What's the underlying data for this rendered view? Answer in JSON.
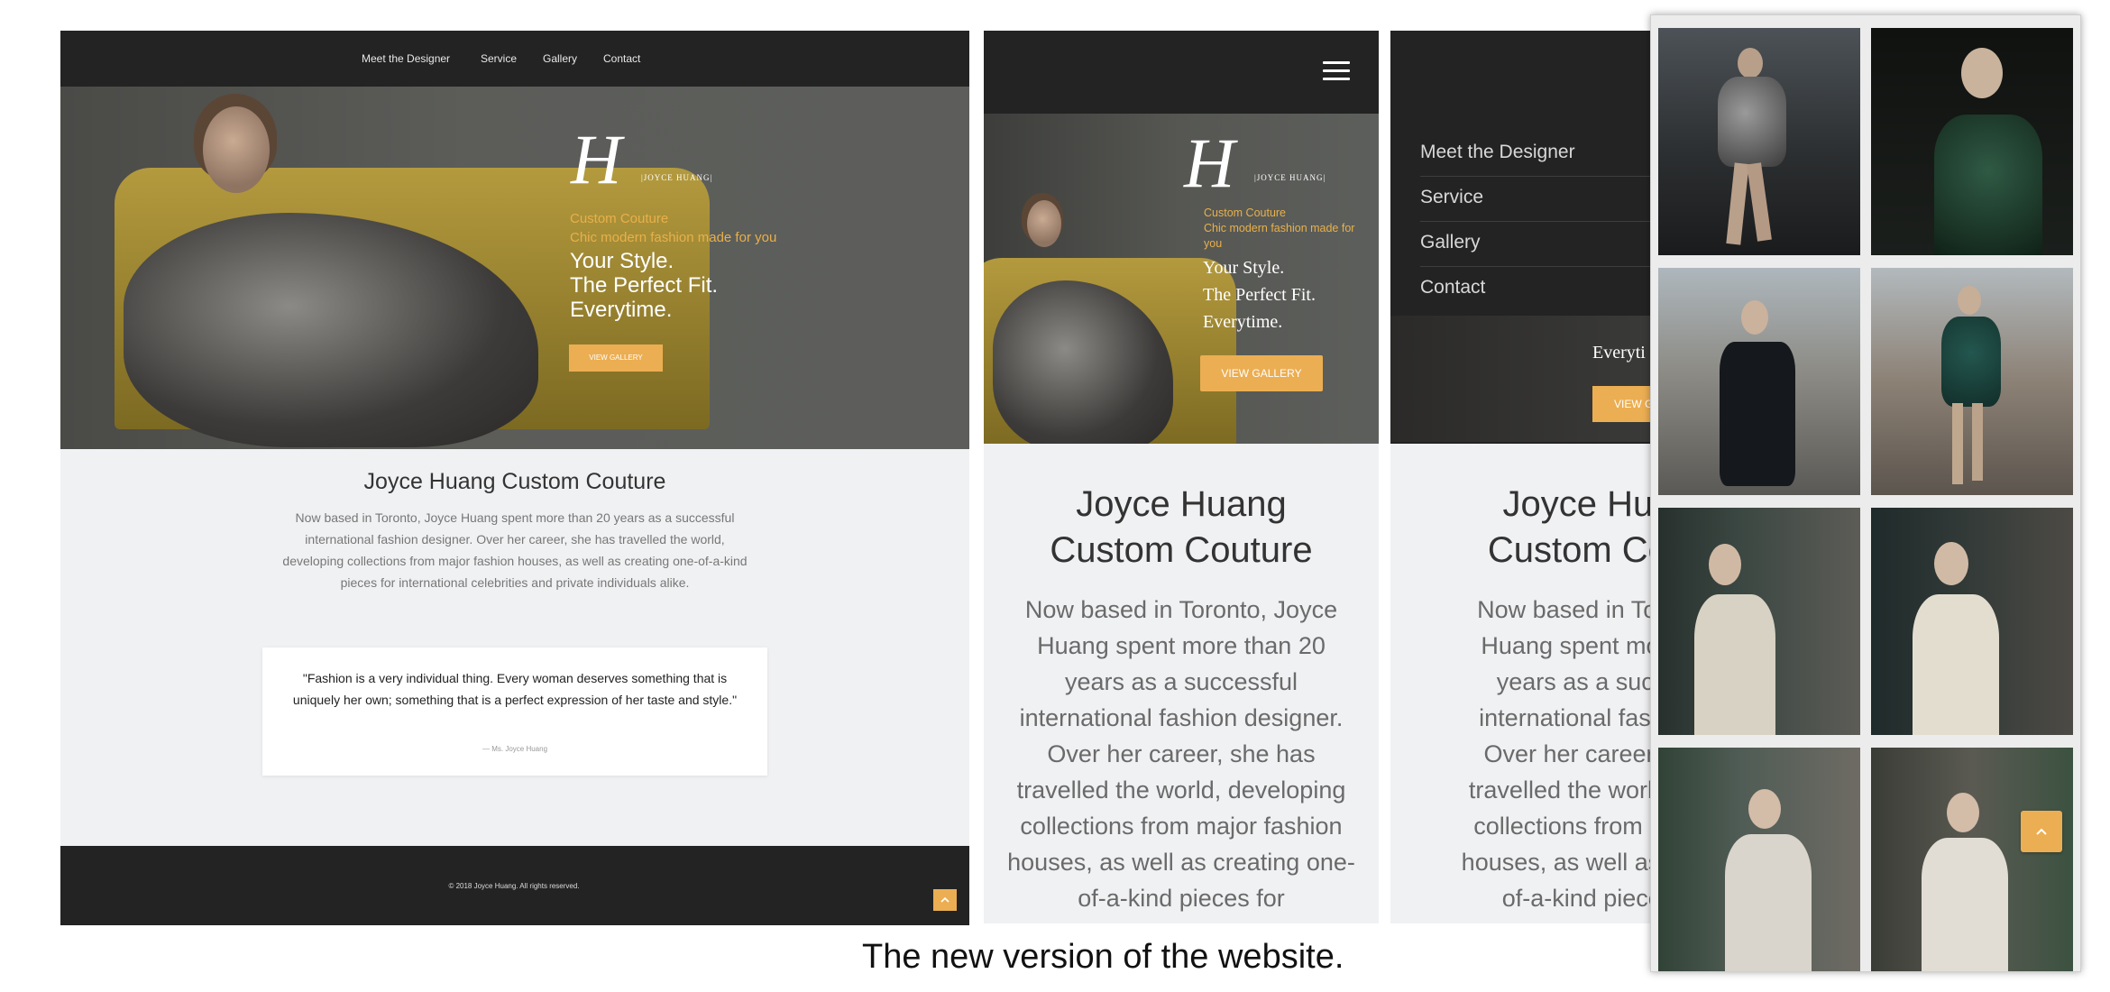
{
  "desktop": {
    "nav": [
      "Meet the Designer",
      "Service",
      "Gallery",
      "Contact"
    ],
    "logo_name": "|JOYCE HUANG|",
    "tagline1": "Custom Couture",
    "tagline2": "Chic modern fashion made for you",
    "headline": [
      "Your Style.",
      "The Perfect Fit.",
      "Everytime."
    ],
    "cta": "VIEW GALLERY",
    "section_title": "Joyce Huang Custom Couture",
    "about": "Now based in Toronto, Joyce Huang spent more than 20 years as a successful international fashion designer. Over her career, she has travelled the world, developing collections from major fashion houses, as well as creating one-of-a-kind pieces for international celebrities and private individuals alike.",
    "quote": "\"Fashion is a very individual thing. Every woman deserves something that is uniquely her own; something that is a perfect expression of her taste and style.\"",
    "quote_author": "— Ms. Joyce Huang",
    "footer": "© 2018 Joyce Huang. All rights reserved.",
    "up_icon": "chevron-up-icon"
  },
  "mobile": {
    "menu_icon": "hamburger-menu-icon",
    "logo_name": "|JOYCE HUANG|",
    "tagline1": "Custom Couture",
    "tagline2": "Chic modern fashion made for you",
    "headline": [
      "Your Style.",
      "The Perfect Fit.",
      "Everytime."
    ],
    "cta": "VIEW GALLERY",
    "section_title": [
      "Joyce Huang",
      "Custom Couture"
    ],
    "about_lines": [
      "Now based in Toronto, Joyce",
      "Huang spent more than 20",
      "years as a successful",
      "international fashion designer.",
      "Over her career, she has",
      "travelled the world, developing",
      "collections from major fashion",
      "houses, as well as creating one-",
      "of-a-kind pieces for"
    ]
  },
  "mobile_menu": {
    "items": [
      "Meet the Designer",
      "Service",
      "Gallery",
      "Contact"
    ],
    "peek_headline": "Everyti",
    "peek_cta": "VIEW G",
    "section_title": [
      "Joyce Hua",
      "Custom Cou"
    ],
    "about_lines": [
      "Now based in Toront",
      "Huang spent more t",
      "years as a succe",
      "international fashion",
      "Over her career, sh",
      "travelled the world, de",
      "collections from majo",
      "houses, as well as crea",
      "of-a-kind pieces"
    ]
  },
  "gallery": {
    "up_icon": "chevron-up-icon"
  },
  "caption": "The new  version of the website."
}
